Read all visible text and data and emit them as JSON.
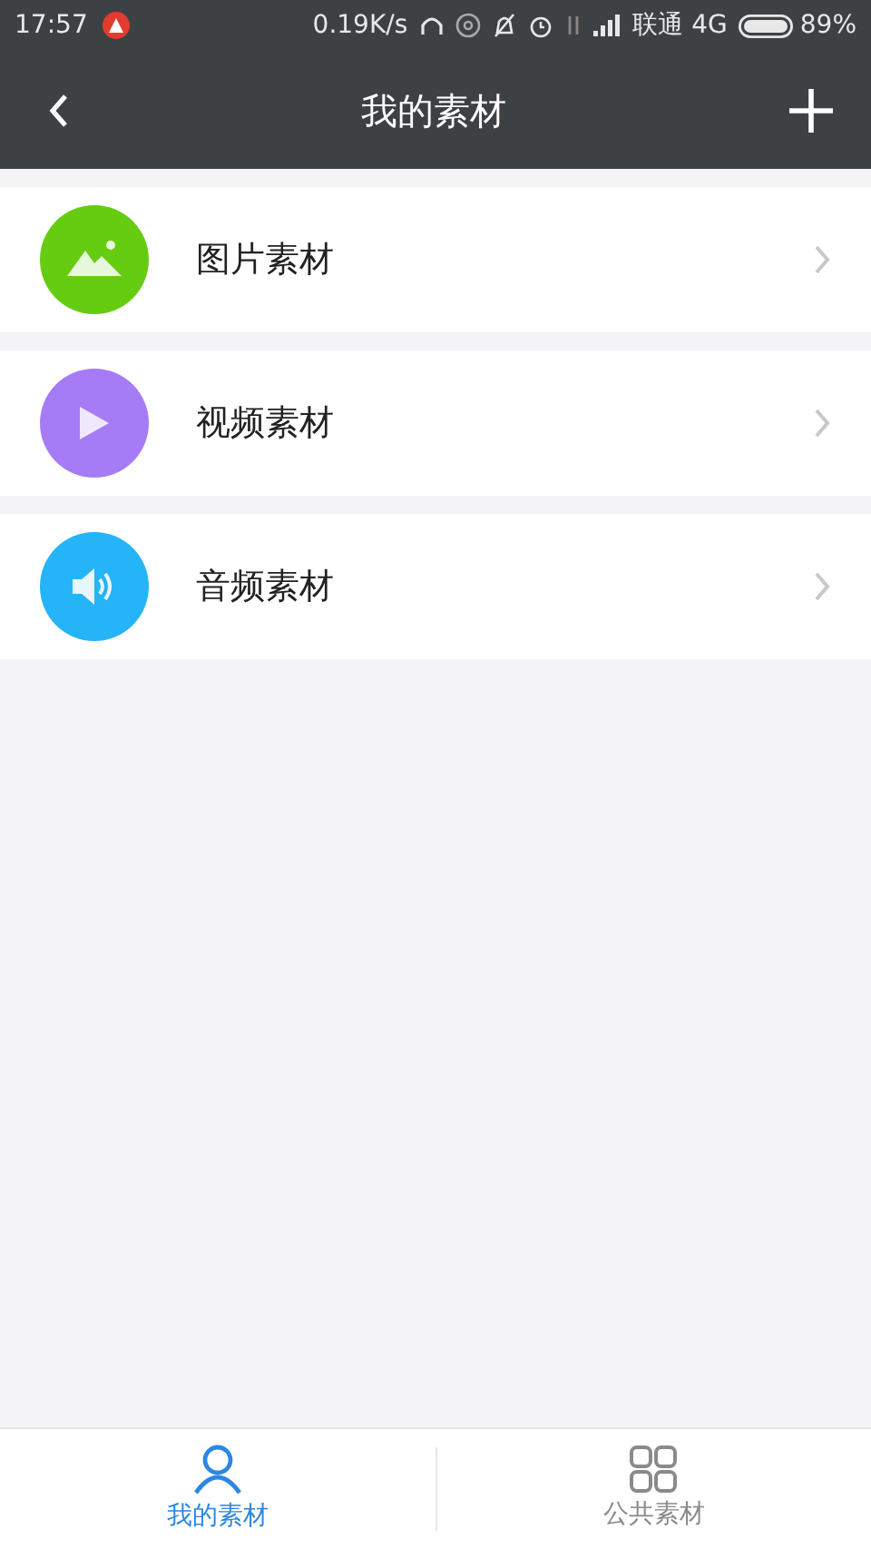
{
  "status_bar": {
    "time": "17:57",
    "speed": "0.19K/s",
    "carrier": "联通 4G",
    "battery": "89%"
  },
  "header": {
    "title": "我的素材"
  },
  "items": [
    {
      "kind": "image",
      "label": "图片素材",
      "color": "#66cc11"
    },
    {
      "kind": "video",
      "label": "视频素材",
      "color": "#a57cf6"
    },
    {
      "kind": "audio",
      "label": "音频素材",
      "color": "#24b4f7"
    }
  ],
  "tabs": [
    {
      "kind": "person",
      "label": "我的素材",
      "selected": true
    },
    {
      "kind": "grid",
      "label": "公共素材",
      "selected": false
    }
  ]
}
